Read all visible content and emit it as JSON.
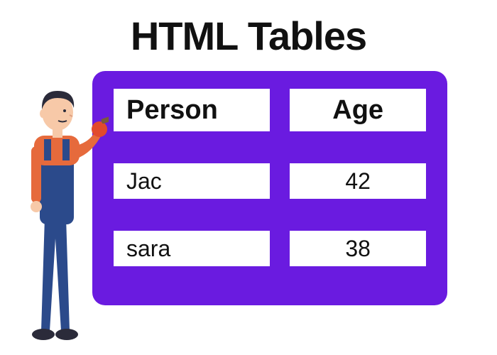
{
  "title": "HTML Tables",
  "chart_data": {
    "type": "table",
    "columns": [
      "Person",
      "Age"
    ],
    "rows": [
      {
        "person": "Jac",
        "age": "42"
      },
      {
        "person": "sara",
        "age": "38"
      }
    ]
  },
  "illustration": {
    "name": "painter-man",
    "shirt_color": "#e66a3c",
    "overalls_color": "#2b4a8b",
    "glove_color": "#e24a2d",
    "skin_color": "#f7c9a8",
    "hair_color": "#2b2b3a"
  }
}
